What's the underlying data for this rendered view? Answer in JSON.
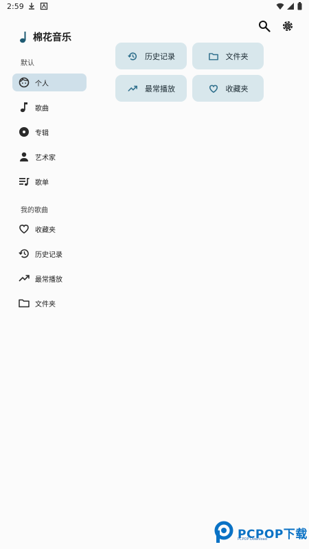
{
  "status_bar": {
    "time": "2:59"
  },
  "app": {
    "title": "棉花音乐"
  },
  "sections": {
    "default_label": "默认",
    "my_songs_label": "我的歌曲"
  },
  "nav_default": [
    {
      "label": "个人",
      "icon": "face-icon",
      "active": true
    },
    {
      "label": "歌曲",
      "icon": "music-note-icon"
    },
    {
      "label": "专辑",
      "icon": "album-icon"
    },
    {
      "label": "艺术家",
      "icon": "person-icon"
    },
    {
      "label": "歌单",
      "icon": "playlist-icon"
    }
  ],
  "nav_my_songs": [
    {
      "label": "收藏夹",
      "icon": "heart-icon"
    },
    {
      "label": "历史记录",
      "icon": "history-icon"
    },
    {
      "label": "最常播放",
      "icon": "trending-up-icon"
    },
    {
      "label": "文件夹",
      "icon": "folder-icon"
    }
  ],
  "cards": [
    {
      "label": "历史记录",
      "icon": "history-icon"
    },
    {
      "label": "文件夹",
      "icon": "folder-icon"
    },
    {
      "label": "最常播放",
      "icon": "trending-up-icon"
    },
    {
      "label": "收藏夹",
      "icon": "heart-icon"
    }
  ],
  "watermark": {
    "text": "PCPOP下载",
    "subtext": "PCPOP Download"
  },
  "colors": {
    "accent": "#2f6f8c",
    "active_nav_bg": "#cfe0ea",
    "card_bg": "#d8e7ec",
    "watermark": "#0a72c5"
  }
}
